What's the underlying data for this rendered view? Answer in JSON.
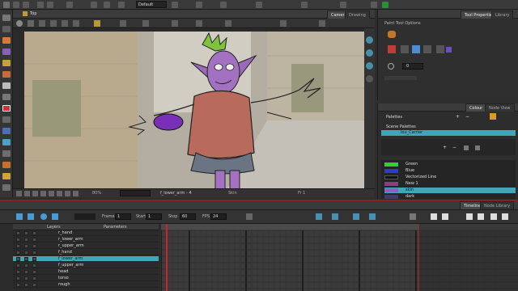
{
  "top_toolbar": {
    "preset": "Default"
  },
  "viewer": {
    "tab_label": "Top",
    "tabs": [
      {
        "label": "Camera",
        "active": true
      },
      {
        "label": "Drawing",
        "active": false
      }
    ],
    "zoom": "80%",
    "status_drawing": "f_lower_arm - 4",
    "status_layer": "Skin",
    "status_frame": "Fr 1"
  },
  "right_top": {
    "tabs": [
      {
        "label": "Tool Properties",
        "active": true
      },
      {
        "label": "Library",
        "active": false
      }
    ],
    "section_title": "Paint Tool Options",
    "field_value": "0"
  },
  "right_bottom": {
    "tabs": [
      {
        "label": "Colour",
        "active": true
      },
      {
        "label": "Node View",
        "active": false
      }
    ],
    "palettes_title": "Palettes",
    "scene_palettes": "Scene Palettes",
    "palette_name": "lou_Carrier",
    "swatches": [
      {
        "name": "Green",
        "color": "#2fd13b"
      },
      {
        "name": "Blue",
        "color": "#2b3ccf"
      },
      {
        "name": "Vectorized Line",
        "color": "#111111"
      },
      {
        "name": "New 1",
        "color": "#8b3d8c"
      },
      {
        "name": "skin",
        "color": "#9b58c7",
        "selected": true
      },
      {
        "name": "dark",
        "color": "#3c3c6a"
      }
    ]
  },
  "timeline": {
    "tabs": [
      {
        "label": "Timeline",
        "active": true
      },
      {
        "label": "Node Library",
        "active": false
      }
    ],
    "frame_label": "Frame",
    "frame": "1",
    "start_label": "Start",
    "start": "1",
    "stop_label": "Stop",
    "stop": "60",
    "fps_label": "FPS",
    "fps": "24",
    "layers_header": "Layers",
    "params_header": "Parameters",
    "layers": [
      {
        "name": "r_hand",
        "selected": false
      },
      {
        "name": "r_lower_arm",
        "selected": false
      },
      {
        "name": "r_upper_arm",
        "selected": false
      },
      {
        "name": "f_hand",
        "selected": false
      },
      {
        "name": "f_lower_arm",
        "selected": true
      },
      {
        "name": "f_upper_arm",
        "selected": false
      },
      {
        "name": "head",
        "selected": false
      },
      {
        "name": "torso",
        "selected": false
      },
      {
        "name": "rough",
        "selected": false
      }
    ]
  },
  "colors": {
    "accent": "#3fa7b8",
    "playhead": "#d02424",
    "panel": "#2e2e2e"
  }
}
